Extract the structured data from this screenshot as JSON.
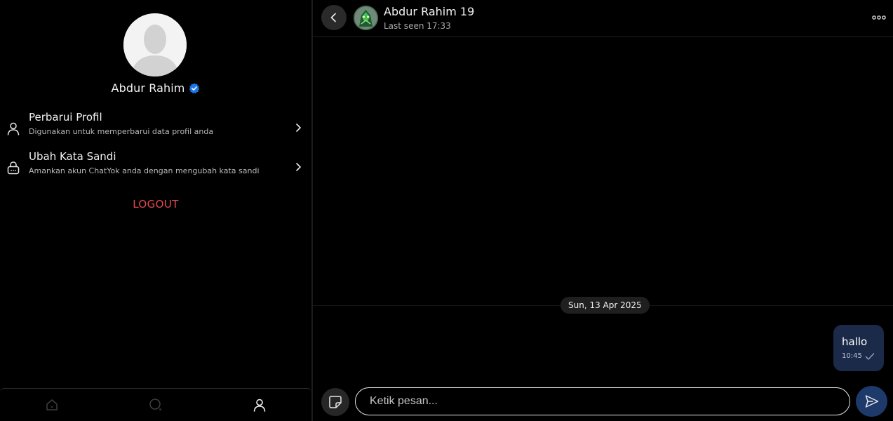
{
  "profile": {
    "name": "Abdur Rahim",
    "verified_color": "#1d76e8"
  },
  "settings_menu": [
    {
      "icon": "user-icon",
      "title": "Perbarui Profil",
      "subtitle": "Digunakan untuk memperbarui data profil anda"
    },
    {
      "icon": "lock-icon",
      "title": "Ubah Kata Sandi",
      "subtitle": "Amankan akun ChatYok anda dengan mengubah kata sandi"
    }
  ],
  "logout_label": "LOGOUT",
  "bottom_nav": [
    {
      "icon": "home-icon",
      "active": false
    },
    {
      "icon": "search-icon",
      "active": false
    },
    {
      "icon": "profile-icon",
      "active": true
    }
  ],
  "chat": {
    "contact_name": "Abdur Rahim 19",
    "status": "Last seen 17:33",
    "date_separator": "Sun, 13 Apr 2025",
    "messages": [
      {
        "text": "hallo",
        "time": "10:45",
        "outgoing": true,
        "status": "sent"
      }
    ],
    "input_placeholder": "Ketik pesan...",
    "input_value": ""
  },
  "colors": {
    "background": "#000000",
    "logout": "#e5484d",
    "bubble_outgoing": "#1c2a4a",
    "send_button": "#1d3a6b"
  }
}
